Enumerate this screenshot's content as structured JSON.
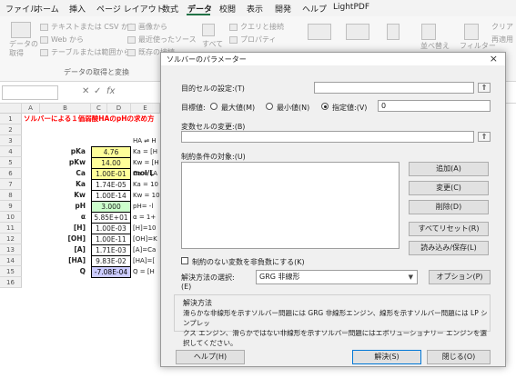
{
  "menubar": {
    "items": [
      "ファイル",
      "ホーム",
      "挿入",
      "ページ レイアウト",
      "数式",
      "データ",
      "校閲",
      "表示",
      "開発",
      "ヘルプ",
      "LightPDF"
    ],
    "active": "データ"
  },
  "ribbon": {
    "get_data": "データの\n取得",
    "from_text_csv": "テキストまたは CSV から",
    "from_web": "Web から",
    "from_table": "テーブルまたは範囲から",
    "from_picture": "画像から",
    "recent_sources": "最近使ったソース",
    "existing_conn": "既存の接続",
    "refresh_all": "すべて",
    "queries_conn": "クエリと接続",
    "properties": "プロパティ",
    "sort": "並べ替え",
    "filter": "フィルター",
    "clear": "クリア",
    "reapply": "再適用",
    "group_label": "データの取得と変換"
  },
  "formula_bar": {
    "fx": "fx"
  },
  "sheet": {
    "columns": [
      "A",
      "B",
      "C",
      "D",
      "E"
    ],
    "rows": [
      "1",
      "2",
      "3",
      "4",
      "5",
      "6",
      "7",
      "8",
      "9",
      "10",
      "11",
      "12",
      "13",
      "14",
      "15",
      "16"
    ],
    "title": "ソルバーによる１価弱酸HAのpHの求め方",
    "labels": [
      "pKa",
      "pKw",
      "Ca",
      "Ka",
      "Kw",
      "pH",
      "α",
      "[H]",
      "[OH]",
      "[A]",
      "[HA]",
      "Q"
    ],
    "values": [
      "4.76",
      "14.00",
      "1.00E-01",
      "1.74E-05",
      "1.00E-14",
      "3.000",
      "5.85E+01",
      "1.00E-03",
      "1.00E-11",
      "1.71E-03",
      "9.83E-02",
      "-7.08E-04"
    ],
    "unit_ca": "mol/L",
    "formulas": [
      "HA ⇌ H",
      "Ka = [H",
      "Kw = [H",
      "Ca = [A",
      "Ka = 10",
      "Kw = 10",
      "pH= -l",
      "α = 1+",
      "[H]=10",
      "[OH]=K",
      "[A]=Ca",
      "[HA]=[",
      "Q = [H"
    ],
    "colors": {
      "yellow": "#ffff99",
      "green": "#ccffcc",
      "blue": "#ccccff",
      "red_text": "#ff0000"
    }
  },
  "dialog": {
    "title": "ソルバーのパラメーター",
    "objective_label": "目的セルの設定:(T)",
    "target_label": "目標値:",
    "radio_max": "最大値(M)",
    "radio_min": "最小値(N)",
    "radio_value": "指定値:(V)",
    "target_value": "0",
    "variable_label": "変数セルの変更:(B)",
    "constraints_label": "制約条件の対象:(U)",
    "btn_add": "追加(A)",
    "btn_change": "変更(C)",
    "btn_delete": "削除(D)",
    "btn_reset": "すべてリセット(R)",
    "btn_load_save": "読み込み/保存(L)",
    "nonneg_label": "制約のない変数を非負数にする(K)",
    "method_label": "解決方法の選択:",
    "method_label2": "(E)",
    "method_value": "GRG 非線形",
    "btn_options": "オプション(P)",
    "method_group_title": "解決方法",
    "method_desc_1": "滑らかな非線形を示すソルバー問題には GRG 非線形エンジン、線形を示すソルバー問題には LP シンプレッ",
    "method_desc_2": "クス エンジン、滑らかではない非線形を示すソルバー問題にはエボリューショナリー エンジンを選択してください。",
    "btn_help": "ヘルプ(H)",
    "btn_solve": "解決(S)",
    "btn_close": "閉じる(O)",
    "close_glyph": "×",
    "ref_glyph": "⇑"
  }
}
